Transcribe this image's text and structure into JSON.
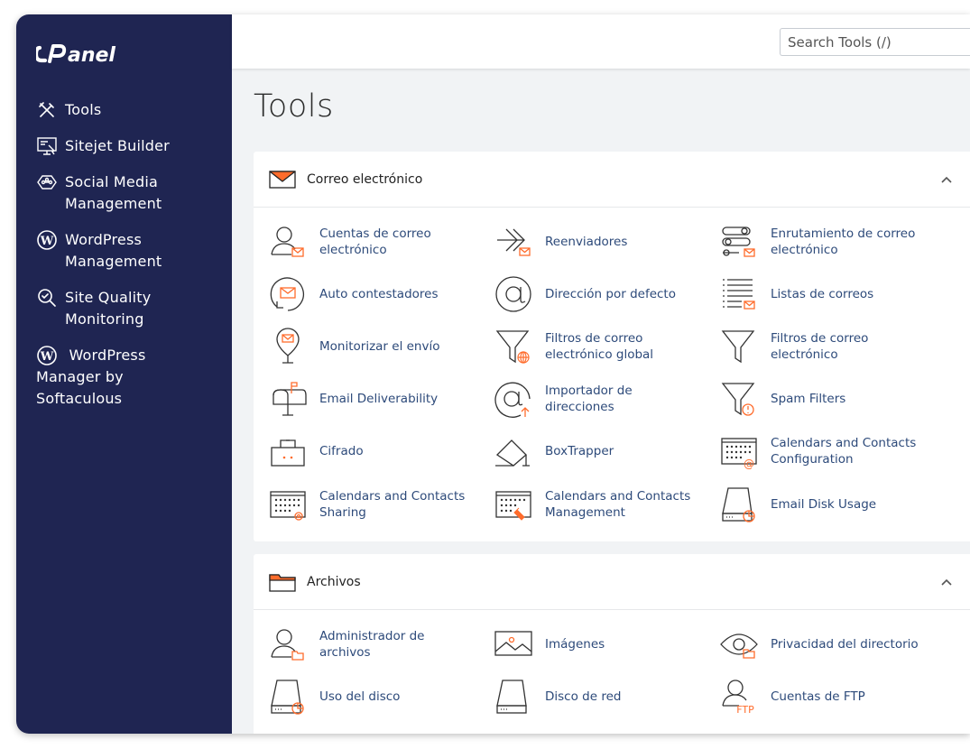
{
  "app": {
    "logo_text": "cPanel"
  },
  "search": {
    "placeholder": "Search Tools (/)",
    "value": ""
  },
  "page": {
    "title": "Tools"
  },
  "sidebar": {
    "items": [
      {
        "label": "Tools",
        "icon": "tools-icon"
      },
      {
        "label": "Sitejet Builder",
        "icon": "sitejet-icon"
      },
      {
        "label": "Social Media Management",
        "icon": "social-media-icon"
      },
      {
        "label": "WordPress Management",
        "icon": "wordpress-icon"
      },
      {
        "label": "Site Quality Monitoring",
        "icon": "site-quality-icon"
      },
      {
        "label": "WordPress Manager by Softaculous",
        "icon": "wordpress-icon"
      }
    ]
  },
  "sections": [
    {
      "title": "Correo electrónico",
      "icon": "envelope-icon",
      "tools": [
        {
          "label": "Cuentas de correo electrónico",
          "icon": "email-accounts-icon"
        },
        {
          "label": "Reenviadores",
          "icon": "forwarders-icon"
        },
        {
          "label": "Enrutamiento de correo electrónico",
          "icon": "email-routing-icon"
        },
        {
          "label": "Auto contestadores",
          "icon": "autoresponders-icon"
        },
        {
          "label": "Dirección por defecto",
          "icon": "default-address-icon"
        },
        {
          "label": "Listas de correos",
          "icon": "mailing-lists-icon"
        },
        {
          "label": "Monitorizar el envío",
          "icon": "track-delivery-icon"
        },
        {
          "label": "Filtros de correo electrónico global",
          "icon": "global-filters-icon"
        },
        {
          "label": "Filtros de correo electrónico",
          "icon": "email-filters-icon"
        },
        {
          "label": "Email Deliverability",
          "icon": "email-deliverability-icon"
        },
        {
          "label": "Importador de direcciones",
          "icon": "address-importer-icon"
        },
        {
          "label": "Spam Filters",
          "icon": "spam-filters-icon"
        },
        {
          "label": "Cifrado",
          "icon": "encryption-icon"
        },
        {
          "label": "BoxTrapper",
          "icon": "boxtrapper-icon"
        },
        {
          "label": "Calendars and Contacts Configuration",
          "icon": "calendars-config-icon"
        },
        {
          "label": "Calendars and Contacts Sharing",
          "icon": "calendars-sharing-icon"
        },
        {
          "label": "Calendars and Contacts Management",
          "icon": "calendars-management-icon"
        },
        {
          "label": "Email Disk Usage",
          "icon": "email-disk-usage-icon"
        }
      ]
    },
    {
      "title": "Archivos",
      "icon": "folder-icon",
      "tools": [
        {
          "label": "Administrador de archivos",
          "icon": "file-manager-icon"
        },
        {
          "label": "Imágenes",
          "icon": "images-icon"
        },
        {
          "label": "Privacidad del directorio",
          "icon": "directory-privacy-icon"
        },
        {
          "label": "Uso del disco",
          "icon": "disk-usage-icon"
        },
        {
          "label": "Disco de red",
          "icon": "web-disk-icon"
        },
        {
          "label": "Cuentas de FTP",
          "icon": "ftp-accounts-icon"
        }
      ]
    }
  ],
  "colors": {
    "sidebar": "#1f2552",
    "accent": "#ff6c2c",
    "link": "#2d4a7a",
    "icon_stroke": "#333333"
  }
}
